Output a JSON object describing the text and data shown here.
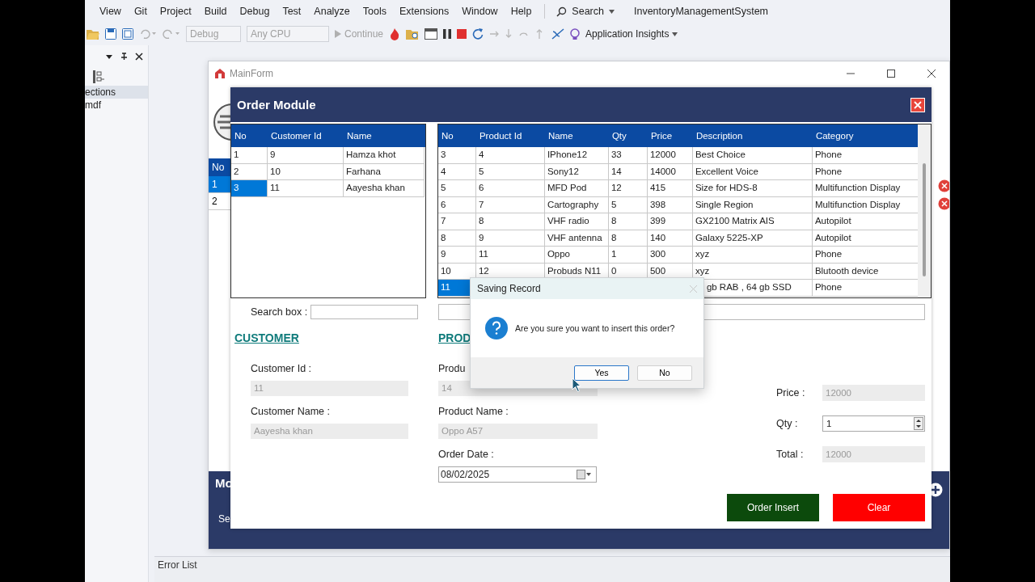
{
  "menu_bar": {
    "items": [
      "View",
      "Git",
      "Project",
      "Build",
      "Debug",
      "Test",
      "Analyze",
      "Tools",
      "Extensions",
      "Window",
      "Help"
    ],
    "search": "Search",
    "solution_name": "InventoryManagementSystem"
  },
  "toolbar": {
    "configuration": "Debug",
    "platform": "Any CPU",
    "continue": "Continue",
    "insights": "Application Insights"
  },
  "side_panel": {
    "items": [
      {
        "label": "ections",
        "selected": true
      },
      {
        "label": "mdf",
        "selected": false
      }
    ]
  },
  "main_form": {
    "title": "MainForm",
    "grid": {
      "header": "No",
      "rows": [
        {
          "label": "1",
          "selected": true
        },
        {
          "label": "2",
          "selected": false
        }
      ]
    },
    "bottom_panel": {
      "title": "Mo",
      "label": "Se"
    }
  },
  "order_module": {
    "title": "Order Module",
    "customer_table": {
      "columns": [
        "No",
        "Customer Id",
        "Name"
      ],
      "rows": [
        {
          "cells": [
            "1",
            "9",
            "Hamza khot"
          ],
          "selected": false
        },
        {
          "cells": [
            "2",
            "10",
            "Farhana"
          ],
          "selected": false
        },
        {
          "cells": [
            "3",
            "11",
            "Aayesha khan"
          ],
          "selected": true
        }
      ]
    },
    "product_table": {
      "columns": [
        "No",
        "Product Id",
        "Name",
        "Qty",
        "Price",
        "Description",
        "Category"
      ],
      "rows": [
        {
          "cells": [
            "3",
            "4",
            "IPhone12",
            "33",
            "12000",
            "Best Choice",
            "Phone"
          ],
          "selected": false
        },
        {
          "cells": [
            "4",
            "5",
            "Sony12",
            "14",
            "14000",
            "Excellent Voice",
            "Phone"
          ],
          "selected": false
        },
        {
          "cells": [
            "5",
            "6",
            "MFD Pod",
            "12",
            "415",
            "Size for HDS-8",
            "Multifunction Display"
          ],
          "selected": false
        },
        {
          "cells": [
            "6",
            "7",
            "Cartography",
            "5",
            "398",
            "Single Region",
            "Multifunction Display"
          ],
          "selected": false
        },
        {
          "cells": [
            "7",
            "8",
            "VHF radio",
            "8",
            "399",
            "GX2100 Matrix AIS",
            "Autopilot"
          ],
          "selected": false
        },
        {
          "cells": [
            "8",
            "9",
            "VHF antenna",
            "8",
            "140",
            "Galaxy 5225-XP",
            "Autopilot"
          ],
          "selected": false
        },
        {
          "cells": [
            "9",
            "11",
            "Oppo",
            "1",
            "300",
            "xyz",
            "Phone"
          ],
          "selected": false
        },
        {
          "cells": [
            "10",
            "12",
            "Probuds N11",
            "0",
            "500",
            "xyz",
            "Blutooth device"
          ],
          "selected": false
        },
        {
          "cells": [
            "11",
            null,
            null,
            null,
            null,
            "gb RAB , 64 gb SSD",
            "Phone"
          ],
          "selected": true
        }
      ]
    },
    "search_label": "Search box :",
    "customer_heading": "CUSTOMER",
    "product_heading": "PROD",
    "customer_fields": [
      {
        "label": "Customer Id :",
        "value": "11"
      },
      {
        "label": "Customer Name :",
        "value": "Aayesha khan"
      }
    ],
    "product_fields": [
      {
        "label": "Produ",
        "value": "14"
      },
      {
        "label": "Product Name :",
        "value": "Oppo A57"
      }
    ],
    "order_date": {
      "label": "Order Date :",
      "value": "08/02/2025"
    },
    "amount_fields": [
      {
        "label": "Price :",
        "value": "12000",
        "kind": "readonly"
      },
      {
        "label": "Qty :",
        "value": "1",
        "kind": "spinner"
      },
      {
        "label": "Total :",
        "value": "12000",
        "kind": "readonly"
      }
    ],
    "buttons": [
      {
        "label": "Order Insert",
        "kind": "primary"
      },
      {
        "label": "Clear",
        "kind": "danger"
      }
    ]
  },
  "dialog": {
    "title": "Saving Record",
    "message": "Are you sure you want to insert this order?",
    "buttons": [
      {
        "label": "Yes",
        "selected": true
      },
      {
        "label": "No",
        "selected": false
      }
    ]
  },
  "error_list": {
    "title": "Error List"
  }
}
